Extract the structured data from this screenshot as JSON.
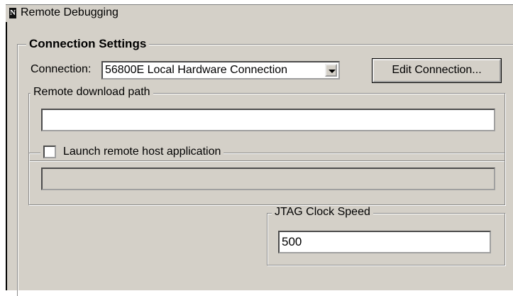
{
  "window": {
    "title": "Remote Debugging",
    "icon": "app-icon"
  },
  "connection_settings": {
    "legend": "Connection Settings",
    "connection_label": "Connection:",
    "connection_value": "56800E Local Hardware Connection",
    "edit_button": "Edit Connection..."
  },
  "remote_download": {
    "legend": "Remote download path",
    "value": ""
  },
  "launch_remote": {
    "label": "Launch remote host application",
    "checked": false,
    "value": ""
  },
  "jtag": {
    "legend": "JTAG Clock Speed",
    "value": "500"
  }
}
